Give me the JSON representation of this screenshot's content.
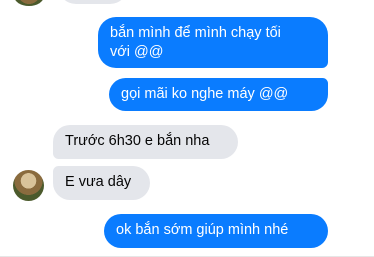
{
  "messages": [
    {
      "direction": "outgoing",
      "lines": [
        "bắn mình để mình chạy tối",
        "với @@"
      ]
    },
    {
      "direction": "outgoing",
      "lines": [
        "gọi mãi ko nghe máy @@"
      ]
    },
    {
      "direction": "incoming",
      "lines": [
        "Trước 6h30 e bắn nha"
      ]
    },
    {
      "direction": "incoming",
      "lines": [
        "E vưa dây"
      ]
    },
    {
      "direction": "outgoing",
      "lines": [
        "ok bắn sớm giúp mình nhé"
      ]
    }
  ],
  "colors": {
    "outgoing_bubble": "#0a7cff",
    "incoming_bubble": "#e4e6eb",
    "outgoing_text": "#ffffff",
    "incoming_text": "#050505"
  }
}
